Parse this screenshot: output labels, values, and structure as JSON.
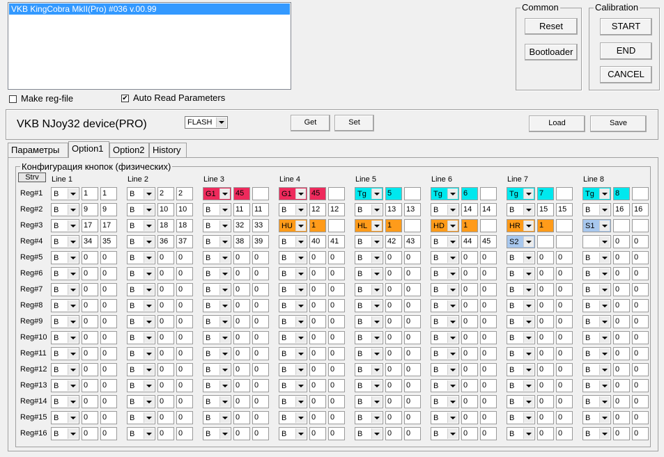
{
  "device_list": {
    "selected": "VKB KingCobra MkII(Pro)  #036  v.00.99"
  },
  "options": {
    "make_reg_file": {
      "label": "Make reg-file",
      "checked": false
    },
    "auto_read": {
      "label": "Auto Read Parameters",
      "checked": true
    }
  },
  "common": {
    "title": "Common",
    "reset": "Reset",
    "bootloader": "Bootloader"
  },
  "calibration": {
    "title": "Calibration",
    "start": "START",
    "end": "END",
    "cancel": "CANCEL"
  },
  "device_panel": {
    "title": "VKB NJoy32 device(PRO)",
    "memory": "FLASH",
    "get": "Get",
    "set": "Set",
    "load": "Load",
    "save": "Save"
  },
  "tabs": [
    "Параметры",
    "Option1",
    "Option2",
    "History"
  ],
  "active_tab": 1,
  "config": {
    "title": "Конфигурация кнопок (физических)",
    "strv_label": "Strv",
    "lines": [
      "Line 1",
      "Line 2",
      "Line 3",
      "Line 4",
      "Line 5",
      "Line 6",
      "Line 7",
      "Line 8"
    ],
    "row_labels": [
      "Reg#1",
      "Reg#2",
      "Reg#3",
      "Reg#4",
      "Reg#5",
      "Reg#6",
      "Reg#7",
      "Reg#8",
      "Reg#9",
      "Reg#10",
      "Reg#11",
      "Reg#12",
      "Reg#13",
      "Reg#14",
      "Reg#15",
      "Reg#16"
    ],
    "colors": {
      "G1": "#ee2a5c",
      "Tg": "#00e8ee",
      "HX": "#ff9b1a",
      "S": "#a8c8ee"
    },
    "special_rows": [
      [
        [
          "B",
          "1",
          "1",
          ""
        ],
        [
          "B",
          "2",
          "2",
          ""
        ],
        [
          "G1",
          "45",
          "",
          "G1"
        ],
        [
          "G1",
          "45",
          "",
          "G1"
        ],
        [
          "Tg",
          "5",
          "",
          "Tg"
        ],
        [
          "Tg",
          "6",
          "",
          "Tg"
        ],
        [
          "Tg",
          "7",
          "",
          "Tg"
        ],
        [
          "Tg",
          "8",
          "",
          "Tg"
        ]
      ],
      [
        [
          "B",
          "9",
          "9",
          ""
        ],
        [
          "B",
          "10",
          "10",
          ""
        ],
        [
          "B",
          "11",
          "11",
          ""
        ],
        [
          "B",
          "12",
          "12",
          ""
        ],
        [
          "B",
          "13",
          "13",
          ""
        ],
        [
          "B",
          "14",
          "14",
          ""
        ],
        [
          "B",
          "15",
          "15",
          ""
        ],
        [
          "B",
          "16",
          "16",
          ""
        ]
      ],
      [
        [
          "B",
          "17",
          "17",
          ""
        ],
        [
          "B",
          "18",
          "18",
          ""
        ],
        [
          "B",
          "32",
          "33",
          ""
        ],
        [
          "HU",
          "1",
          "",
          "HX"
        ],
        [
          "HL",
          "1",
          "",
          "HX"
        ],
        [
          "HD",
          "1",
          "",
          "HX"
        ],
        [
          "HR",
          "1",
          "",
          "HX"
        ],
        [
          "S1",
          "",
          "",
          "S"
        ]
      ],
      [
        [
          "B",
          "34",
          "35",
          ""
        ],
        [
          "B",
          "36",
          "37",
          ""
        ],
        [
          "B",
          "38",
          "39",
          ""
        ],
        [
          "B",
          "40",
          "41",
          ""
        ],
        [
          "B",
          "42",
          "43",
          ""
        ],
        [
          "B",
          "44",
          "45",
          ""
        ],
        [
          "S2",
          "",
          "",
          "S"
        ],
        [
          "",
          "0",
          "0",
          ""
        ]
      ]
    ],
    "default_cell": [
      "B",
      "0",
      "0",
      ""
    ]
  }
}
